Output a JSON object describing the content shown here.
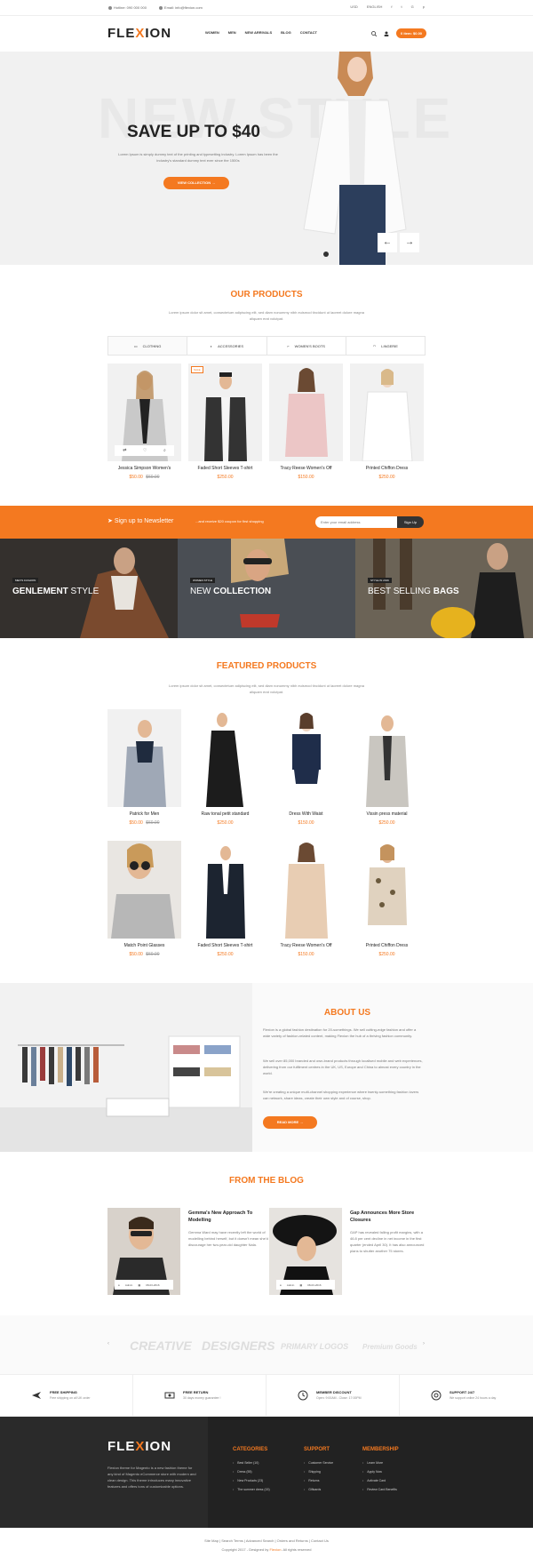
{
  "topbar": {
    "hotline": "Hotline: 090 000 000",
    "email": "Email: info@flexion.com",
    "currency": "USD",
    "language": "ENGLISH"
  },
  "header": {
    "logo_a": "FLE",
    "logo_x": "X",
    "logo_b": "ION",
    "nav": [
      "WOMEN",
      "MEN",
      "NEW ARRIVALS",
      "BLOG",
      "CONTACT"
    ],
    "cart": "0 item: $0.00"
  },
  "hero": {
    "bg_text": "NEW STYLE",
    "title": "SAVE UP TO $40",
    "desc": "Lorem Ipsum is simply dummy text of the printing and typesetting industry. Lorem Ipsum has been the industry's standard dummy text ever since the 1500s",
    "button": "VIEW COLLECTION"
  },
  "our_products": {
    "title": "OUR PRODUCTS",
    "desc": "Lorem ipsum dolor sit amet, consectetuer adipiscing elit, sed diam nonummy nibh euismod tincidunt ut laoreet dolore magna aliquam erat volutpat.",
    "tabs": [
      "CLOTHING",
      "ACCESSORIES",
      "WOMEN'S BOOTS",
      "LINGERIE"
    ],
    "items": [
      {
        "name": "Jessica Simpson Women's",
        "price": "$50.00",
        "old": "$60.00"
      },
      {
        "name": "Faded Short Sleeves T-shirt",
        "price": "$250.00",
        "old": "",
        "tag": "SALE"
      },
      {
        "name": "Tracy Reese Women's Off",
        "price": "$150.00",
        "old": ""
      },
      {
        "name": "Printed Chiffon Dress",
        "price": "$250.00",
        "old": ""
      }
    ]
  },
  "newsletter": {
    "title": "Sign up to Newsletter",
    "sub": "...and receive $20 coupon for first shopping",
    "placeholder": "Enter your email address",
    "button": "Sign Up"
  },
  "banners": [
    {
      "label": "MEN'S FASHION",
      "bold": "GENLEMENT",
      "light": " STYLE"
    },
    {
      "label": "WOMEN STYLE",
      "bold": "NEW ",
      "light": "COLLECTION"
    },
    {
      "label": "STYLE IN 2016",
      "bold": "BEST SELLING ",
      "light": "BAGS"
    }
  ],
  "featured": {
    "title": "FEATURED PRODUCTS",
    "desc": "Lorem ipsum dolor sit amet, consectetuer adipiscing elit, sed diam nonummy nibh euismod tincidunt ut laoreet dolore magna aliquam erat volutpat.",
    "items": [
      {
        "name": "Patrick for Men",
        "price": "$50.00",
        "old": "$60.00"
      },
      {
        "name": "Raw tonal petit standard",
        "price": "$250.00",
        "old": ""
      },
      {
        "name": "Dress With Waist",
        "price": "$150.00",
        "old": ""
      },
      {
        "name": "Vissin press material",
        "price": "$250.00",
        "old": ""
      },
      {
        "name": "Match Point Glasses",
        "price": "$50.00",
        "old": "$60.00"
      },
      {
        "name": "Faded Short Sleeves T-shirt",
        "price": "$250.00",
        "old": ""
      },
      {
        "name": "Tracy Reese Women's Off",
        "price": "$150.00",
        "old": ""
      },
      {
        "name": "Printed Chiffon Dress",
        "price": "$250.00",
        "old": ""
      }
    ]
  },
  "about": {
    "title": "ABOUT US",
    "p1": "Flexion is a global fashion destination for 20-somethings. We sell cutting-edge fashion and offer a wide variety of fashion-related content, making Flexion the hub of a thriving fashion community.",
    "p2": "We sell over 85,000 branded and own-brand products through localised mobile and web experiences, delivering from our fulfilment centres in the UK, US, Europe and China to almost every country in the world.",
    "p3": "We're creating a unique multi-channel shopping experience where twenty-something fashion lovers can network, share ideas, create their own style and of course, shop.",
    "button": "READ MORE"
  },
  "blog": {
    "title": "FROM THE BLOG",
    "posts": [
      {
        "title": "Gemma's New Approach To Modelling",
        "text": "Gemma Ward may have recently left the world of modelling behind herself, but it doesn't mean she'd discourage her two-year-old daughter Nala.",
        "author": "Admin",
        "date": "08-03-2016"
      },
      {
        "title": "Gap Announces More Store Closures",
        "text": "GAP has revealed falling profit margins, with a 46.8 per cent decline in net income in the first quarter (ended April 30). It has also announced plans to shutter another 75 stores.",
        "author": "Admin",
        "date": "08-03-2016"
      }
    ]
  },
  "brands": [
    "CREATIVE",
    "DESIGNERS",
    "PRIMARY LOGOS",
    "Premium Goods"
  ],
  "services": [
    {
      "title": "FREE SHIPPING",
      "sub": "Free shipping on all UK order"
    },
    {
      "title": "FREE RETURN",
      "sub": "30 days money guarantee !"
    },
    {
      "title": "MEMBER DISCOUNT",
      "sub": "Open: 9:00AM - Close: 17:00PM"
    },
    {
      "title": "SUPPORT 24/7",
      "sub": "We support online 24 hours a day"
    }
  ],
  "footer": {
    "desc": "Flexion theme for Magento is a new fashion theme for any kind of Magento eCommerce store with modern and clean design. This theme introduces many innovative features and offers tons of customizable options.",
    "categories": {
      "title": "CATEGORIES",
      "items": [
        "Best Seller (10)",
        "Dress (55)",
        "New Products (23)",
        "The summer dress (15)"
      ]
    },
    "support": {
      "title": "SUPPORT",
      "items": [
        "Customer Service",
        "Shipping",
        "Returns",
        "Giftcards"
      ]
    },
    "membership": {
      "title": "MEMBERSHIP",
      "items": [
        "Learn More",
        "Apply Now",
        "Activate Card",
        "Review Card Benefits"
      ]
    },
    "links": "Site Map | Search Terms | Advanced Search | Orders and Returns | Contact Us",
    "copy": "Copyright 2017 - Designed by ",
    "copy_brand": "Flexion",
    "copy_end": ". All rights reserved"
  },
  "colors": {
    "accent": "#f47920",
    "dark": "#222222"
  }
}
